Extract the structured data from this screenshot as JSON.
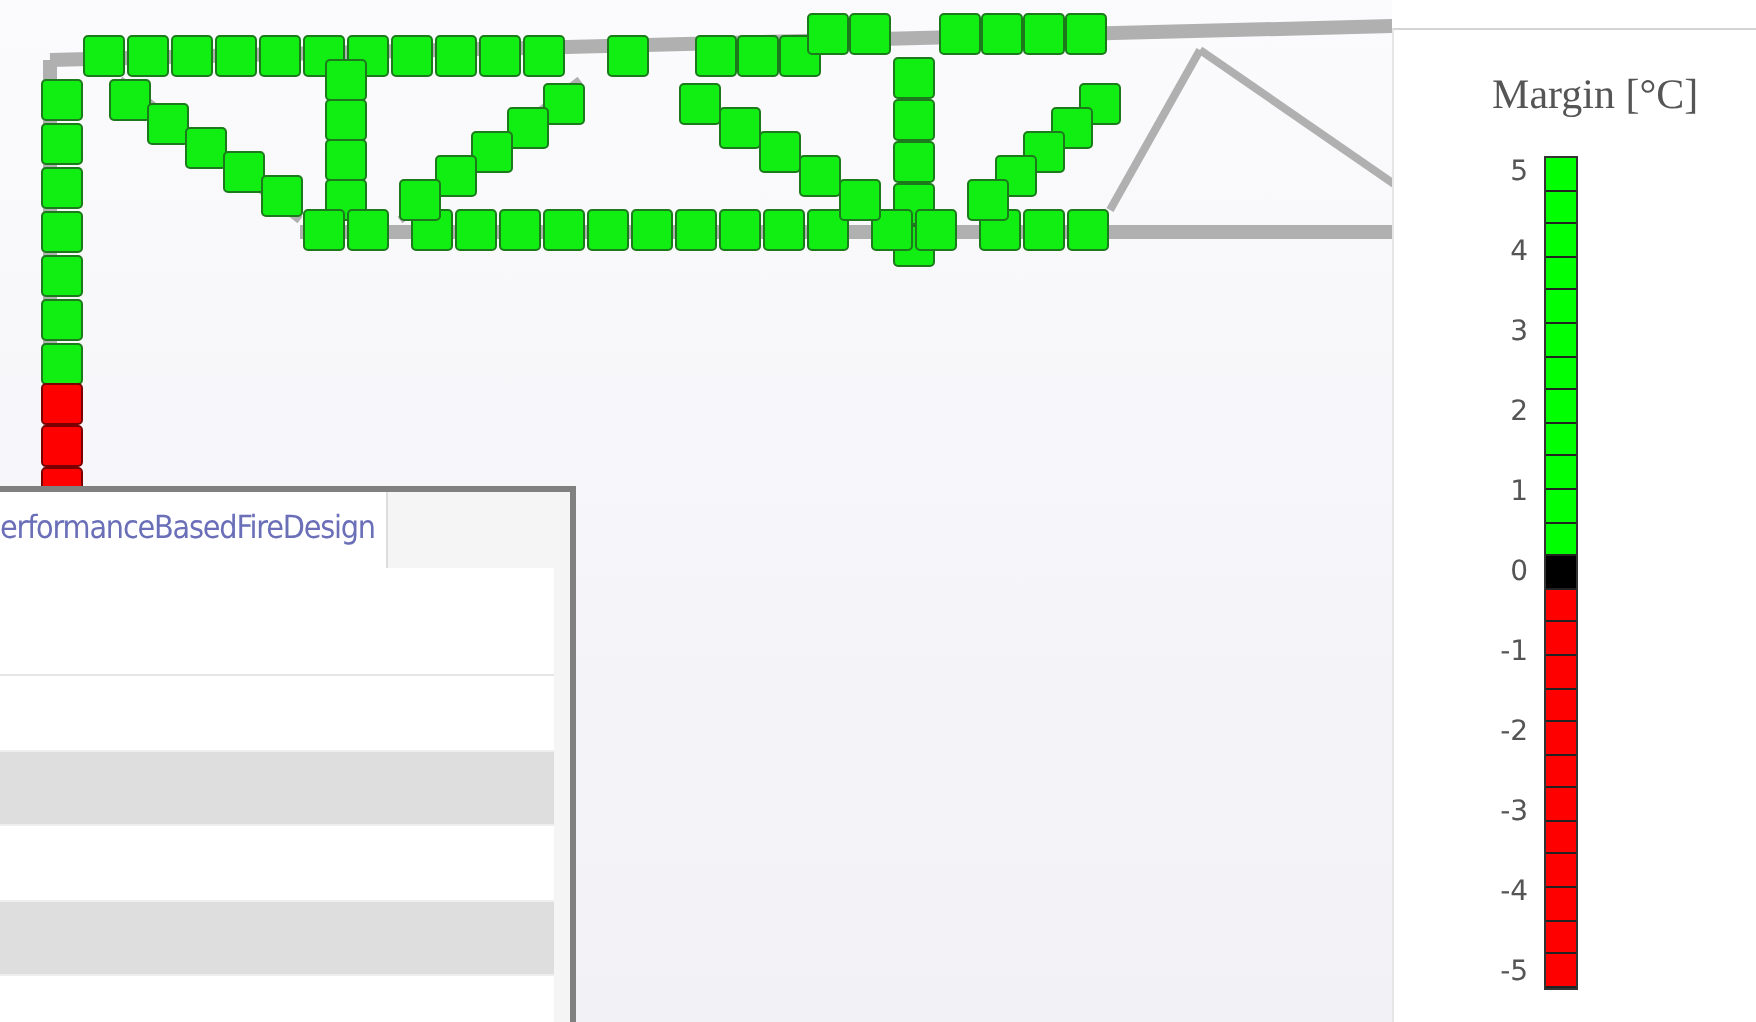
{
  "results_window": {
    "tab": "erformanceBasedFireDesign",
    "rows": [
      {
        "shaded": false
      },
      {
        "shaded": true
      },
      {
        "shaded": false
      },
      {
        "shaded": true
      },
      {
        "shaded": false
      }
    ]
  },
  "legend": {
    "title": "Margin [°C]",
    "labels": [
      "5",
      "4",
      "3",
      "2",
      "1",
      "0",
      "-1",
      "-2",
      "-3",
      "-4",
      "-5"
    ],
    "cells": [
      {
        "color": "#00ff00"
      },
      {
        "color": "#00ff00"
      },
      {
        "color": "#00ff00"
      },
      {
        "color": "#00ff00"
      },
      {
        "color": "#00ff00"
      },
      {
        "color": "#00ff00"
      },
      {
        "color": "#00ff00"
      },
      {
        "color": "#00ff00"
      },
      {
        "color": "#00ff00"
      },
      {
        "color": "#00ff00"
      },
      {
        "color": "#00ff00"
      },
      {
        "color": "#00ff00"
      },
      {
        "color": "#000000"
      },
      {
        "color": "#ff0000"
      },
      {
        "color": "#ff0000"
      },
      {
        "color": "#ff0000"
      },
      {
        "color": "#ff0000"
      },
      {
        "color": "#ff0000"
      },
      {
        "color": "#ff0000"
      },
      {
        "color": "#ff0000"
      },
      {
        "color": "#ff0000"
      },
      {
        "color": "#ff0000"
      },
      {
        "color": "#ff0000"
      },
      {
        "color": "#ff0000"
      },
      {
        "color": "#ff0000"
      }
    ]
  }
}
